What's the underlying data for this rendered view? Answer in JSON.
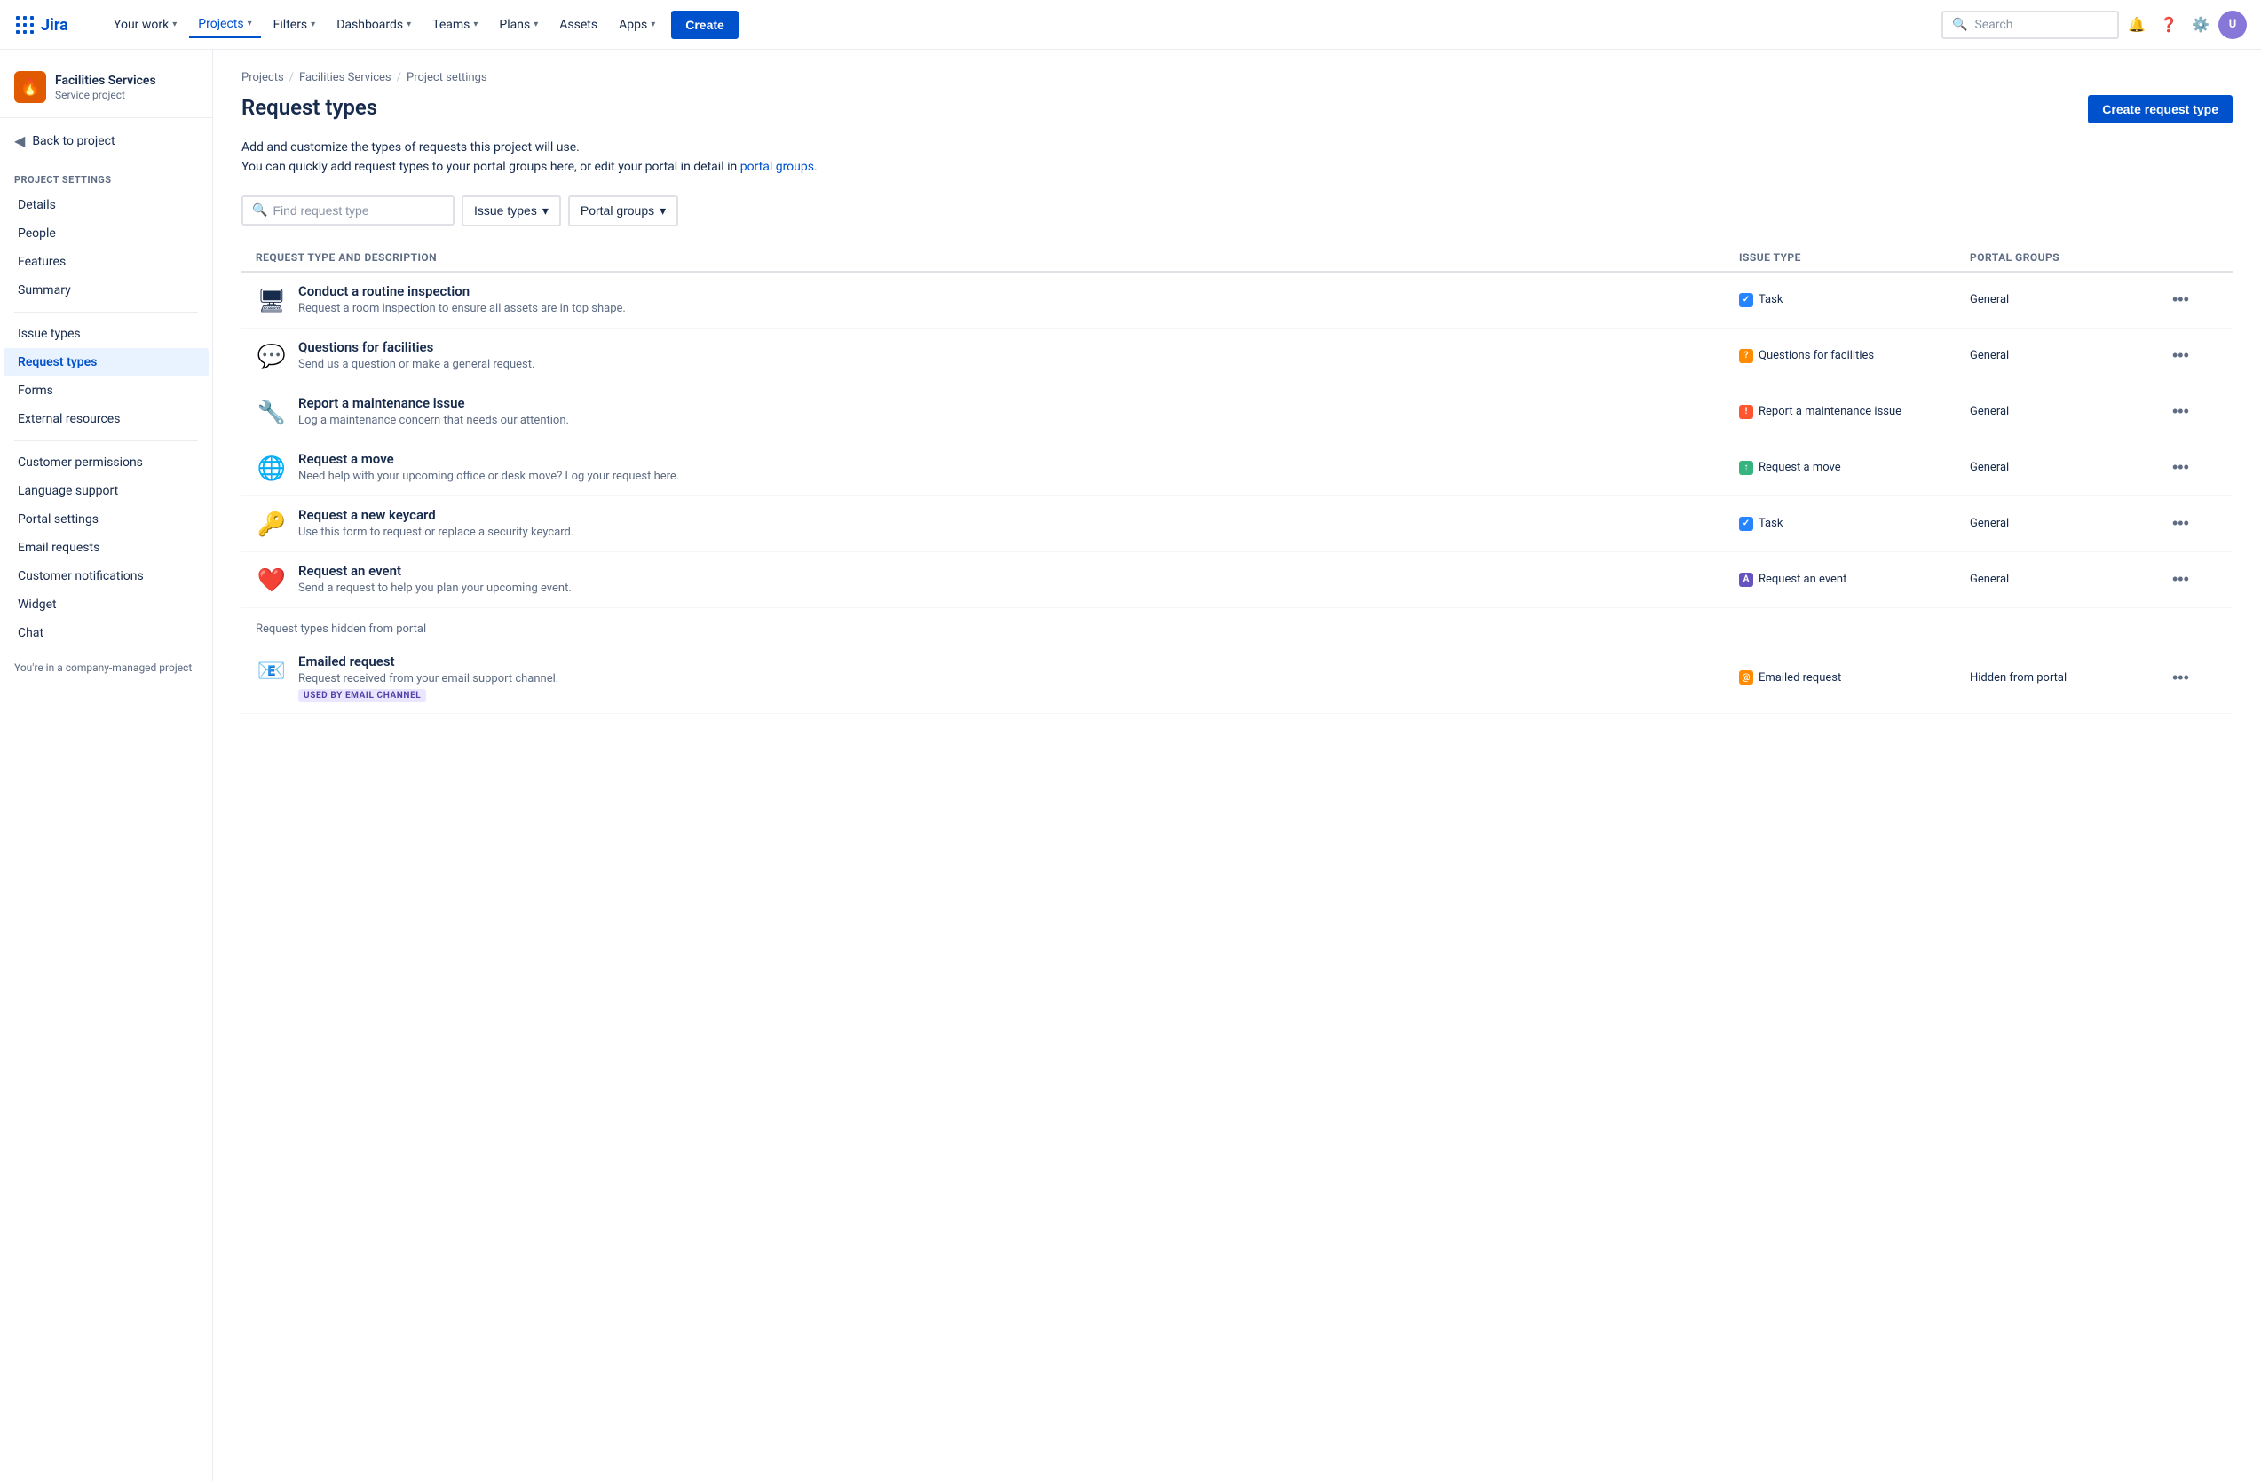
{
  "topnav": {
    "logo_text": "Jira",
    "your_work": "Your work",
    "projects": "Projects",
    "filters": "Filters",
    "dashboards": "Dashboards",
    "teams": "Teams",
    "plans": "Plans",
    "assets": "Assets",
    "apps": "Apps",
    "create": "Create",
    "search_placeholder": "Search"
  },
  "sidebar": {
    "project_name": "Facilities Services",
    "project_type": "Service project",
    "back_label": "Back to project",
    "settings_title": "Project settings",
    "items": [
      {
        "id": "details",
        "label": "Details"
      },
      {
        "id": "people",
        "label": "People"
      },
      {
        "id": "features",
        "label": "Features"
      },
      {
        "id": "summary",
        "label": "Summary"
      },
      {
        "id": "issue-types",
        "label": "Issue types"
      },
      {
        "id": "request-types",
        "label": "Request types",
        "active": true
      },
      {
        "id": "forms",
        "label": "Forms"
      },
      {
        "id": "external-resources",
        "label": "External resources"
      },
      {
        "id": "customer-permissions",
        "label": "Customer permissions"
      },
      {
        "id": "language-support",
        "label": "Language support"
      },
      {
        "id": "portal-settings",
        "label": "Portal settings"
      },
      {
        "id": "email-requests",
        "label": "Email requests"
      },
      {
        "id": "customer-notifications",
        "label": "Customer notifications"
      },
      {
        "id": "widget",
        "label": "Widget"
      },
      {
        "id": "chat",
        "label": "Chat"
      }
    ],
    "footer": "You're in a company-managed project"
  },
  "breadcrumb": {
    "projects": "Projects",
    "facilities": "Facilities Services",
    "settings": "Project settings"
  },
  "page": {
    "title": "Request types",
    "create_btn": "Create request type",
    "desc_line1": "Add and customize the types of requests this project will use.",
    "desc_line2": "You can quickly add request types to your portal groups here, or edit your portal in detail in",
    "portal_groups_link": "portal groups",
    "desc_end": ".",
    "search_placeholder": "Find request type",
    "filter_issue_types": "Issue types",
    "filter_portal_groups": "Portal groups"
  },
  "table": {
    "col_name": "Request type and description",
    "col_issue": "Issue type",
    "col_portal": "Portal groups",
    "rows": [
      {
        "icon": "🖥️",
        "icon_type": "computer",
        "title": "Conduct a routine inspection",
        "desc": "Request a room inspection to ensure all assets are in top shape.",
        "issue_type": "Task",
        "issue_color": "task",
        "portal_group": "General"
      },
      {
        "icon": "💬",
        "icon_type": "chat",
        "title": "Questions for facilities",
        "desc": "Send us a question or make a general request.",
        "issue_type": "Questions for facilities",
        "issue_color": "question",
        "portal_group": "General"
      },
      {
        "icon": "🔧",
        "icon_type": "wrench",
        "title": "Report a maintenance issue",
        "desc": "Log a maintenance concern that needs our attention.",
        "issue_type": "Report a maintenance issue",
        "issue_color": "maintenance",
        "portal_group": "General"
      },
      {
        "icon": "🌐",
        "icon_type": "globe",
        "title": "Request a move",
        "desc": "Need help with your upcoming office or desk move? Log your request here.",
        "issue_type": "Request a move",
        "issue_color": "move",
        "portal_group": "General"
      },
      {
        "icon": "🔑",
        "icon_type": "key",
        "title": "Request a new keycard",
        "desc": "Use this form to request or replace a security keycard.",
        "issue_type": "Task",
        "issue_color": "task",
        "portal_group": "General"
      },
      {
        "icon": "❤️",
        "icon_type": "heart",
        "title": "Request an event",
        "desc": "Send a request to help you plan your upcoming event.",
        "issue_type": "Request an event",
        "issue_color": "event",
        "portal_group": "General"
      }
    ],
    "hidden_section_label": "Request types hidden from portal",
    "hidden_rows": [
      {
        "icon": "📧",
        "icon_type": "email",
        "title": "Emailed request",
        "desc": "Request received from your email support channel.",
        "issue_type": "Emailed request",
        "issue_color": "email",
        "portal_group": "Hidden from portal",
        "badge": "USED BY EMAIL CHANNEL"
      }
    ]
  }
}
